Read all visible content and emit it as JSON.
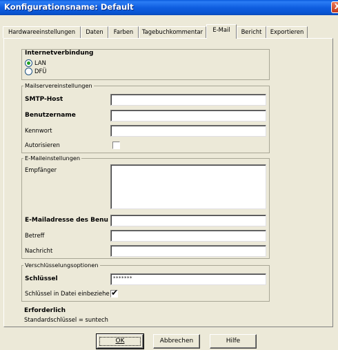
{
  "window": {
    "title": "Konfigurationsname: Default",
    "close_glyph": "X"
  },
  "tabs": [
    {
      "label": "Hardwareeinstellungen"
    },
    {
      "label": "Daten"
    },
    {
      "label": "Farben"
    },
    {
      "label": "Tagebuchkommentar"
    },
    {
      "label": "E-Mail"
    },
    {
      "label": "Bericht"
    },
    {
      "label": "Exportieren"
    }
  ],
  "active_tab": "E-Mail",
  "internet": {
    "title": "Internetverbindung",
    "options": [
      {
        "label": "LAN",
        "selected": true
      },
      {
        "label": "DFÜ",
        "selected": false
      }
    ]
  },
  "mailserver": {
    "title": "Mailservereinstellungen",
    "smtp_label": "SMTP-Host",
    "smtp_value": "",
    "user_label": "Benutzername",
    "user_value": "",
    "password_label": "Kennwort",
    "password_value": "",
    "auth_label": "Autorisieren",
    "auth_checked": false
  },
  "email": {
    "title": "E-Maileinstellungen",
    "recipient_label": "Empfänger",
    "recipient_value": "",
    "sender_label": "E-Mailadresse des Benu",
    "sender_value": "",
    "subject_label": "Betreff",
    "subject_value": "",
    "message_label": "Nachricht",
    "message_value": ""
  },
  "encryption": {
    "title": "Verschlüsselungsoptionen",
    "key_label": "Schlüssel",
    "key_value": "*******",
    "include_label": "Schlüssel in Datei einbeziehe",
    "include_checked": true
  },
  "required": {
    "title": "Erforderlich",
    "note": "Standardschlüssel = suntech"
  },
  "buttons": {
    "ok": "OK",
    "cancel": "Abbrechen",
    "help": "Hilfe"
  },
  "colors": {
    "title_bar": "#0a5bdd",
    "dialog_bg": "#ece9d8",
    "radio_dot": "#21a121"
  }
}
